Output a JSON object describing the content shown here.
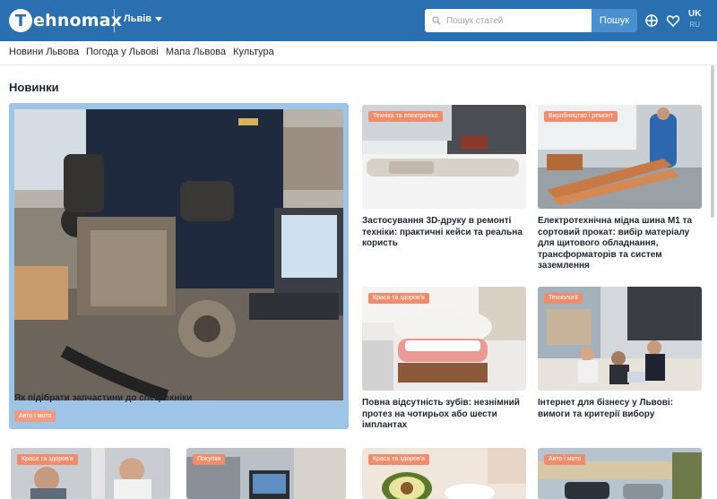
{
  "header": {
    "logo_letter": "T",
    "logo_rest": "ehnomax",
    "city": "Львів",
    "search_placeholder": "Пошук статей",
    "search_button": "Пошук",
    "lang_active": "UK",
    "lang_other": "RU",
    "brand_color": "#2a6fb0"
  },
  "nav": {
    "items": [
      "Новини Львова",
      "Погода у Львові",
      "Мапа Львова",
      "Культура"
    ]
  },
  "main": {
    "section_title": "Новинки",
    "featured": {
      "title": "Як підібрати запчастини до спецтехніки",
      "tag": "Авто і мото"
    },
    "cards": [
      {
        "tag": "Техніка та електроніка",
        "title": "Застосування 3D-друку в ремонті техніки: практичні кейси та реальна користь"
      },
      {
        "tag": "Виробництво і ремонт",
        "title": "Електротехнічна мідна шина М1 та сортовий прокат: вибір матеріалу для щитового обладнання, трансформаторів та систем заземлення"
      },
      {
        "tag": "Краса та здоров'я",
        "title": "Повна відсутність зубів: незнімний протез на чотирьох або шести імплантах"
      },
      {
        "tag": "Технології",
        "title": "Інтернет для бізнесу у Львові: вимоги та критерії вибору"
      }
    ],
    "bottom_tags": [
      "Краса та здоров'я",
      "Покупки",
      "Краса та здоров'я",
      "Авто і мото"
    ]
  }
}
